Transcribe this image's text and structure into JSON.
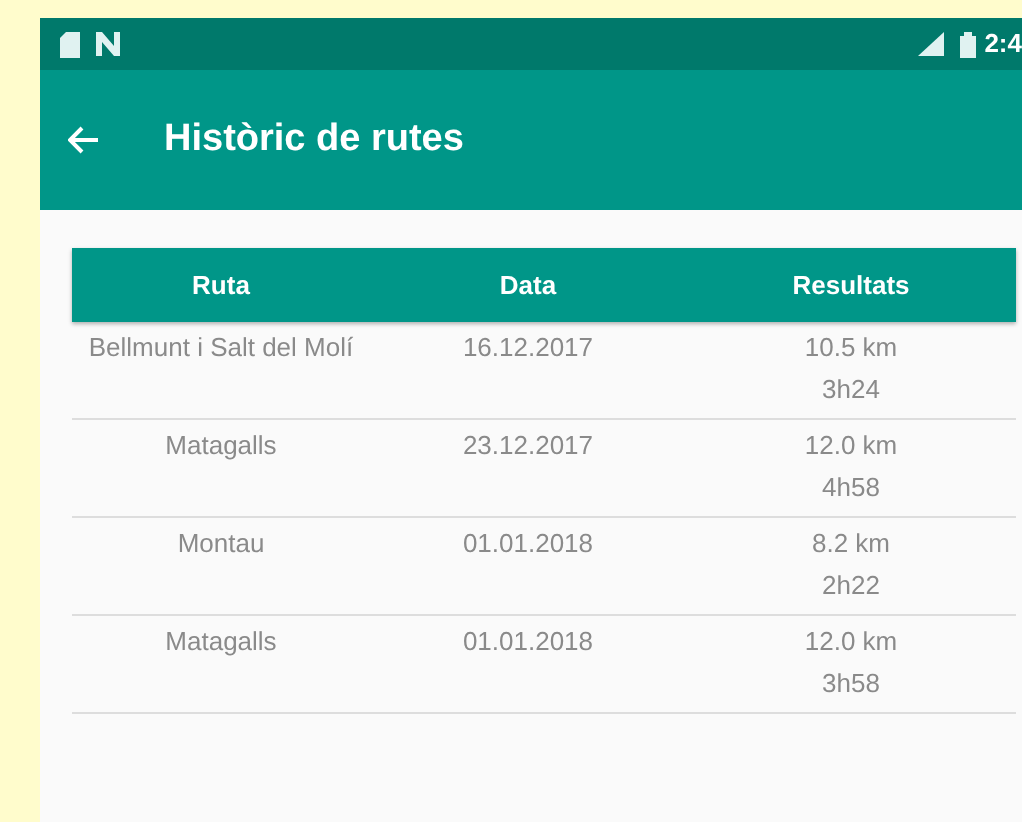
{
  "status_bar": {
    "time": "2:4"
  },
  "app_bar": {
    "title": "Històric de rutes"
  },
  "table": {
    "columns": [
      "Ruta",
      "Data",
      "Resultats"
    ],
    "rows": [
      {
        "route": "Bellmunt i Salt del Molí",
        "date": "16.12.2017",
        "distance": "10.5 km",
        "duration": "3h24"
      },
      {
        "route": "Matagalls",
        "date": "23.12.2017",
        "distance": "12.0 km",
        "duration": "4h58"
      },
      {
        "route": "Montau",
        "date": "01.01.2018",
        "distance": "8.2 km",
        "duration": "2h22"
      },
      {
        "route": "Matagalls",
        "date": "01.01.2018",
        "distance": "12.0 km",
        "duration": "3h58"
      }
    ]
  }
}
